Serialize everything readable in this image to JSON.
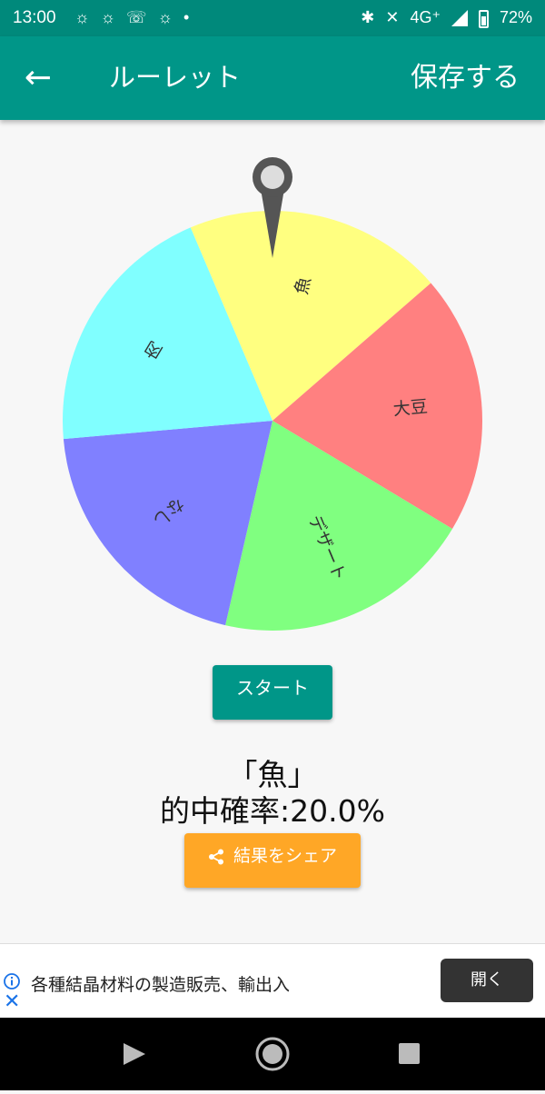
{
  "status_bar": {
    "time": "13:00",
    "network": "4G⁺",
    "battery": "72%",
    "notification_icons": [
      "bug-icon",
      "bug-icon",
      "wifi-calling-on-icon",
      "bug-icon",
      "dot-icon"
    ],
    "system_icons": [
      "bluetooth-icon",
      "mute-icon",
      "signal-icon",
      "battery-icon"
    ]
  },
  "app_bar": {
    "title": "ルーレット",
    "save_label": "保存する",
    "back_icon": "arrow-left-icon"
  },
  "roulette": {
    "segments": [
      {
        "label": "魚",
        "color": "#ffff80"
      },
      {
        "label": "大豆",
        "color": "#ff8080"
      },
      {
        "label": "デザート",
        "color": "#80ff80"
      },
      {
        "label": "なし",
        "color": "#8080ff"
      },
      {
        "label": "肉",
        "color": "#80ffff"
      }
    ],
    "pointer_icon": "map-pin-icon"
  },
  "start_button": {
    "label": "スタート",
    "color": "#009688"
  },
  "result": {
    "text": "「魚」",
    "probability": "的中確率:20.0%"
  },
  "share_button": {
    "label": "結果をシェア",
    "icon": "share-icon",
    "color": "#ffa726"
  },
  "ad": {
    "text": "各種結晶材料の製造販売、輸出入",
    "button_label": "開く",
    "info_icon": "info-icon",
    "close_icon": "close-icon"
  },
  "nav_bar": {
    "icons": [
      "back-triangle-icon",
      "home-circle-icon",
      "recents-square-icon"
    ]
  }
}
